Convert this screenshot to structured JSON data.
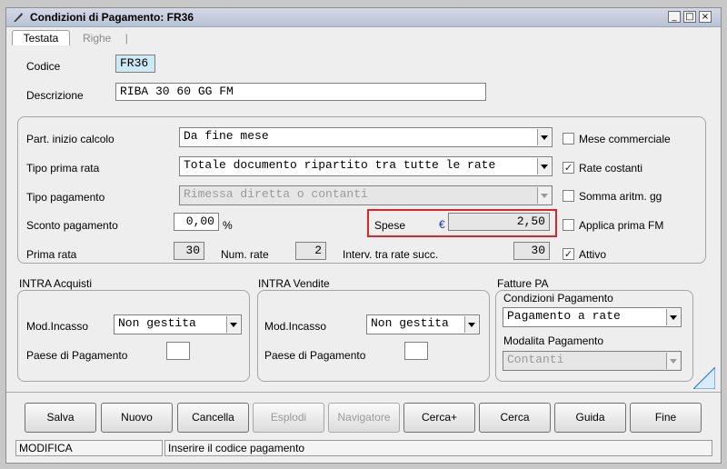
{
  "window": {
    "title": "Condizioni di Pagamento: FR36"
  },
  "tabs": [
    {
      "label": "Testata"
    },
    {
      "label": "Righe"
    }
  ],
  "codice": {
    "label": "Codice",
    "value": "FR36"
  },
  "descrizione": {
    "label": "Descrizione",
    "value": "RIBA 30 60 GG FM"
  },
  "calc": {
    "part_inizio": {
      "label": "Part. inizio calcolo",
      "value": "Da fine mese"
    },
    "tipo_prima_rata": {
      "label": "Tipo prima rata",
      "value": "Totale documento ripartito tra tutte le rate"
    },
    "tipo_pagamento": {
      "label": "Tipo pagamento",
      "value": "Rimessa diretta o contanti"
    },
    "sconto": {
      "label": "Sconto pagamento",
      "value": "0,00",
      "unit": "%"
    },
    "spese": {
      "label": "Spese",
      "currency": "€",
      "value": "2,50"
    },
    "prima_rata": {
      "label": "Prima rata",
      "value": "30"
    },
    "num_rate": {
      "label": "Num. rate",
      "value": "2"
    },
    "interv": {
      "label": "Interv. tra rate succ.",
      "value": "30"
    }
  },
  "checkboxes": {
    "mese_commerciale": {
      "label": "Mese commerciale",
      "checked": false
    },
    "rate_costanti": {
      "label": "Rate costanti",
      "checked": true
    },
    "somma_aritm": {
      "label": "Somma aritm. gg",
      "checked": false
    },
    "applica_prima_fm": {
      "label": "Applica prima FM",
      "checked": false
    },
    "attivo": {
      "label": "Attivo",
      "checked": true
    }
  },
  "intra_acquisti": {
    "title": "INTRA Acquisti",
    "mod_label": "Mod.Incasso",
    "mod_value": "Non gestita",
    "paese_label": "Paese di Pagamento",
    "paese_value": ""
  },
  "intra_vendite": {
    "title": "INTRA Vendite",
    "mod_label": "Mod.Incasso",
    "mod_value": "Non gestita",
    "paese_label": "Paese di Pagamento",
    "paese_value": ""
  },
  "fatture_pa": {
    "title": "Fatture PA",
    "cond_label": "Condizioni Pagamento",
    "cond_value": "Pagamento a rate",
    "mod_label": "Modalita Pagamento",
    "mod_value": "Contanti"
  },
  "buttons": {
    "salva": "Salva",
    "nuovo": "Nuovo",
    "cancella": "Cancella",
    "esplodi": "Esplodi",
    "navigatore": "Navigatore",
    "cerca_plus": "Cerca+",
    "cerca": "Cerca",
    "guida": "Guida",
    "fine": "Fine"
  },
  "status": {
    "mode": "MODIFICA",
    "message": "Inserire il codice pagamento"
  }
}
